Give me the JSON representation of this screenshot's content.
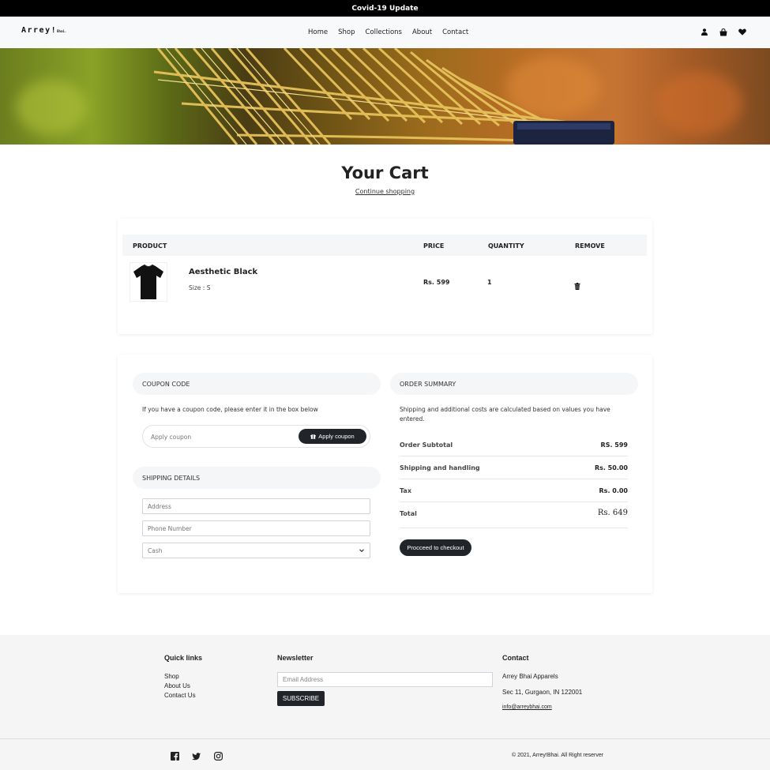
{
  "banner": {
    "text": "Covid-19 Update"
  },
  "nav": {
    "brand": "Arrey!",
    "brand_suffix": "Bhai.",
    "links": [
      "Home",
      "Shop",
      "Collections",
      "About",
      "Contact"
    ],
    "icons": [
      "user-icon",
      "shopping-bag-icon",
      "heart-icon"
    ]
  },
  "cart": {
    "title": "Your Cart",
    "continue_link": "Continue shopping",
    "headers": {
      "product": "PRODUCT",
      "price": "PRICE",
      "quantity": "QUANTITY",
      "remove": "REMOVE"
    },
    "items": [
      {
        "name": "Aesthetic Black",
        "size": "Size : S",
        "price": "Rs. 599",
        "quantity": "1"
      }
    ]
  },
  "coupon": {
    "heading": "COUPON CODE",
    "description": "If you have a coupon code, please enter it in the box below",
    "placeholder": "Apply coupon",
    "button": "Apply coupon"
  },
  "shipping": {
    "heading": "SHIPPING DETAILS",
    "address_placeholder": "Address",
    "phone_placeholder": "Phone Number",
    "payment_selected": "Cash"
  },
  "summary": {
    "heading": "ORDER SUMMARY",
    "description": "Shipping and additional costs are calculated based on values you have entered.",
    "rows": [
      {
        "label": "Order Subtotal",
        "value": "RS. 599"
      },
      {
        "label": "Shipping and handling",
        "value": "Rs. 50.00"
      },
      {
        "label": "Tax",
        "value": "Rs. 0.00"
      },
      {
        "label": "Total",
        "value": "Rs. 649"
      }
    ],
    "checkout_button": "Procceed to checkout"
  },
  "footer": {
    "quick_links_heading": "Quick links",
    "quick_links": [
      "Shop",
      "About Us",
      "Contact Us"
    ],
    "newsletter_heading": "Newsletter",
    "email_placeholder": "Email Address",
    "subscribe_button": "SUBSCRIBE",
    "contact_heading": "Contact",
    "company": "Arrey Bhai Apparels",
    "address": "Sec 11, Gurgaon, IN 122001",
    "email": "info@arreybhai.com",
    "social": [
      "facebook-icon",
      "twitter-icon",
      "instagram-icon"
    ],
    "copyright": "© 2021, Arrey!Bhai. All Right reserver"
  },
  "colors": {
    "dark": "#212529",
    "banner": "#000000",
    "nav_bg": "#f8f9fa",
    "footer_bg": "#f5f5f5"
  }
}
